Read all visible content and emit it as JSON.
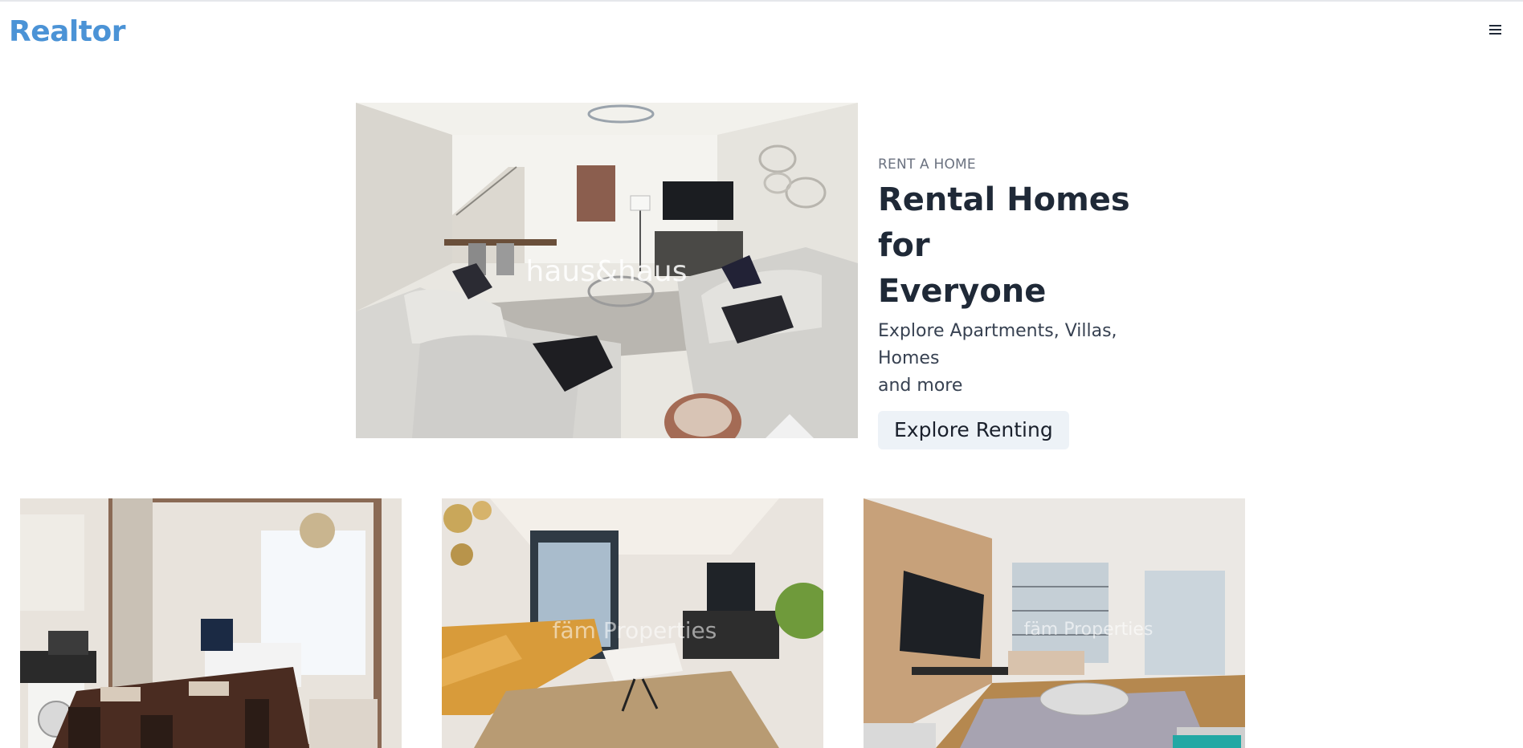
{
  "header": {
    "brand": "Realtor",
    "menu_icon": "hamburger-menu-icon"
  },
  "hero": {
    "kicker": "RENT A HOME",
    "title_line1": "Rental Homes for",
    "title_line2": "Everyone",
    "subtitle_line1": "Explore Apartments, Villas, Homes",
    "subtitle_line2": "and more",
    "button_label": "Explore Renting",
    "image_watermark": "haus&haus"
  },
  "listings": [
    {
      "watermark": ""
    },
    {
      "watermark": "fäm Properties"
    },
    {
      "watermark": "fäm Properties"
    }
  ],
  "colors": {
    "brand": "#4b93d6",
    "button_bg": "#edf2f7",
    "title": "#1f2937"
  }
}
